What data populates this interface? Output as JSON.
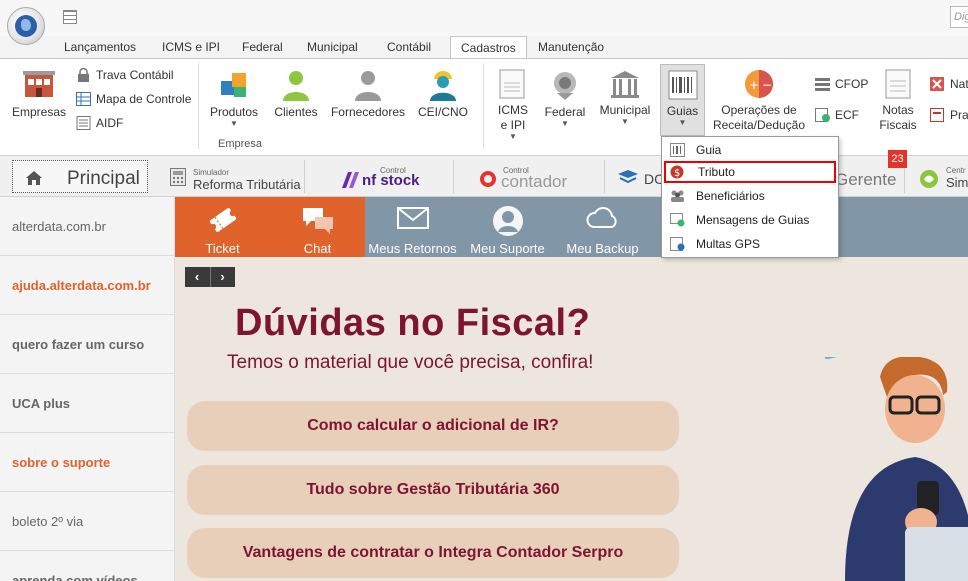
{
  "search": {
    "placeholder": "Dig"
  },
  "ribbon_tabs": [
    "Lançamentos",
    "ICMS e IPI",
    "Federal",
    "Municipal",
    "Contábil",
    "Cadastros",
    "Manutenção"
  ],
  "ribbon": {
    "empresas": "Empresas",
    "trava_contabil": "Trava Contábil",
    "mapa_controle": "Mapa de Controle",
    "aidf": "AIDF",
    "produtos": "Produtos",
    "clientes": "Clientes",
    "fornecedores": "Fornecedores",
    "cei_cno": "CEI/CNO",
    "group_empresa": "Empresa",
    "icms_line1": "ICMS",
    "icms_line2": "e IPI",
    "federal": "Federal",
    "municipal": "Municipal",
    "guias": "Guias",
    "operacoes_line1": "Operações de",
    "operacoes_line2": "Receita/Dedução",
    "cfop": "CFOP",
    "ecf": "ECF",
    "notas_line1": "Notas",
    "notas_line2": "Fiscais",
    "nat": "Nat",
    "pra": "Pra"
  },
  "dropdown": {
    "items": [
      "Guia",
      "Tributo",
      "Beneficiários",
      "Mensagens de Guias",
      "Multas GPS"
    ],
    "selected": "Tributo"
  },
  "badge": {
    "count": "23"
  },
  "module_tabs": {
    "principal": "Principal",
    "simulador_small": "Simulador",
    "simulador_big": "Reforma Tributária",
    "nfstock_small": "Control",
    "nfstock_big": "nf stock",
    "contador_small": "Control",
    "contador_big": "contador",
    "dc": "DC",
    "gerente": "Gerente",
    "sim_small": "Centr",
    "sim_big": "Sim"
  },
  "sidebar": {
    "items": [
      "alterdata.com.br",
      "ajuda.alterdata.com.br",
      "quero fazer um curso",
      "UCA plus",
      "sobre o suporte",
      "boleto 2º via",
      "aprenda com vídeos"
    ]
  },
  "toolbar": {
    "ticket": "Ticket",
    "chat": "Chat",
    "meus_retornos": "Meus Retornos",
    "meu_suporte": "Meu Suporte",
    "meu_backup": "Meu Backup"
  },
  "banner": {
    "title": "Dúvidas no Fiscal?",
    "subtitle": "Temos o material que você precisa, confira!",
    "links": [
      "Como calcular o adicional de IR?",
      "Tudo sobre Gestão Tributária 360",
      "Vantagens de contratar o Integra Contador Serpro"
    ]
  },
  "colors": {
    "accent_orange": "#e0632c",
    "toolbar_band": "#8196a6",
    "banner_text": "#7d1430",
    "pill": "#e8cfb9"
  }
}
